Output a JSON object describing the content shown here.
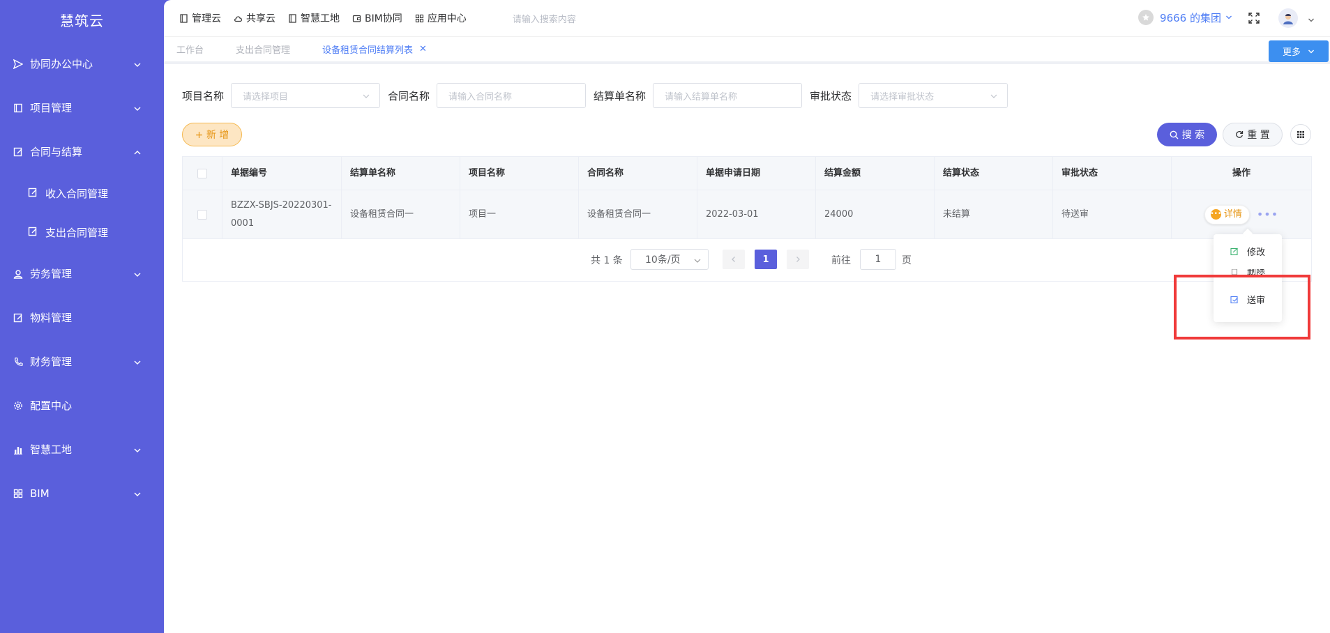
{
  "brand": "慧筑云",
  "sidebar": {
    "items": [
      {
        "label": "协同办公中心",
        "icon": "send-icon",
        "chevron": "down"
      },
      {
        "label": "项目管理",
        "icon": "book-icon",
        "chevron": "down"
      },
      {
        "label": "合同与结算",
        "icon": "edit-icon",
        "chevron": "up"
      },
      {
        "label": "劳务管理",
        "icon": "worker-icon",
        "chevron": "down"
      },
      {
        "label": "物料管理",
        "icon": "edit-icon",
        "chevron": ""
      },
      {
        "label": "财务管理",
        "icon": "phone-icon",
        "chevron": "down"
      },
      {
        "label": "配置中心",
        "icon": "gear-icon",
        "chevron": ""
      },
      {
        "label": "智慧工地",
        "icon": "bar-chart-icon",
        "chevron": "down"
      },
      {
        "label": "BIM",
        "icon": "grid-icon",
        "chevron": "down"
      }
    ],
    "sub_items": [
      {
        "label": "收入合同管理",
        "icon": "edit-icon"
      },
      {
        "label": "支出合同管理",
        "icon": "edit-icon"
      }
    ]
  },
  "topnav": {
    "items": [
      {
        "label": "管理云",
        "icon": "book-icon"
      },
      {
        "label": "共享云",
        "icon": "cloud-icon"
      },
      {
        "label": "智慧工地",
        "icon": "book-icon"
      },
      {
        "label": "BIM协同",
        "icon": "wallet-icon"
      },
      {
        "label": "应用中心",
        "icon": "grid-icon"
      }
    ],
    "search_placeholder": "请输入搜索内容",
    "group_name": "9666 的集团"
  },
  "tabs": [
    {
      "label": "工作台",
      "active": false
    },
    {
      "label": "支出合同管理",
      "active": false
    },
    {
      "label": "设备租赁合同结算列表",
      "active": true
    }
  ],
  "more_label": "更多",
  "filters": [
    {
      "label": "项目名称",
      "placeholder": "请选择项目",
      "type": "select"
    },
    {
      "label": "合同名称",
      "placeholder": "请输入合同名称",
      "type": "input"
    },
    {
      "label": "结算单名称",
      "placeholder": "请输入结算单名称",
      "type": "input"
    },
    {
      "label": "审批状态",
      "placeholder": "请选择审批状态",
      "type": "select"
    }
  ],
  "buttons": {
    "add": "+ 新 增",
    "search": "搜 索",
    "reset": "重 置"
  },
  "table": {
    "columns": [
      "单据编号",
      "结算单名称",
      "项目名称",
      "合同名称",
      "单据申请日期",
      "结算金额",
      "结算状态",
      "审批状态",
      "操作"
    ],
    "rows": [
      {
        "code_line1": "BZZX-SBJS-20220301-",
        "code_line2": "0001",
        "settlement_name": "设备租赁合同一",
        "project_name": "项目一",
        "contract_name": "设备租赁合同一",
        "apply_date": "2022-03-01",
        "amount": "24000",
        "settle_status": "未结算",
        "approve_status": "待送审",
        "detail_label": "详情"
      }
    ]
  },
  "pager": {
    "total": "共 1 条",
    "page_size": "10条/页",
    "current": "1",
    "goto_label": "前往",
    "goto_value": "1",
    "page_label": "页"
  },
  "popover": {
    "edit": "修改",
    "delete": "删除",
    "send": "送审"
  },
  "colors": {
    "sidebar": "#5a5fdc",
    "accent_blue": "#4f7ef5",
    "more_button": "#3c8ff0",
    "add_button_border": "#f5b84e",
    "highlight_box": "#f03a3a"
  }
}
